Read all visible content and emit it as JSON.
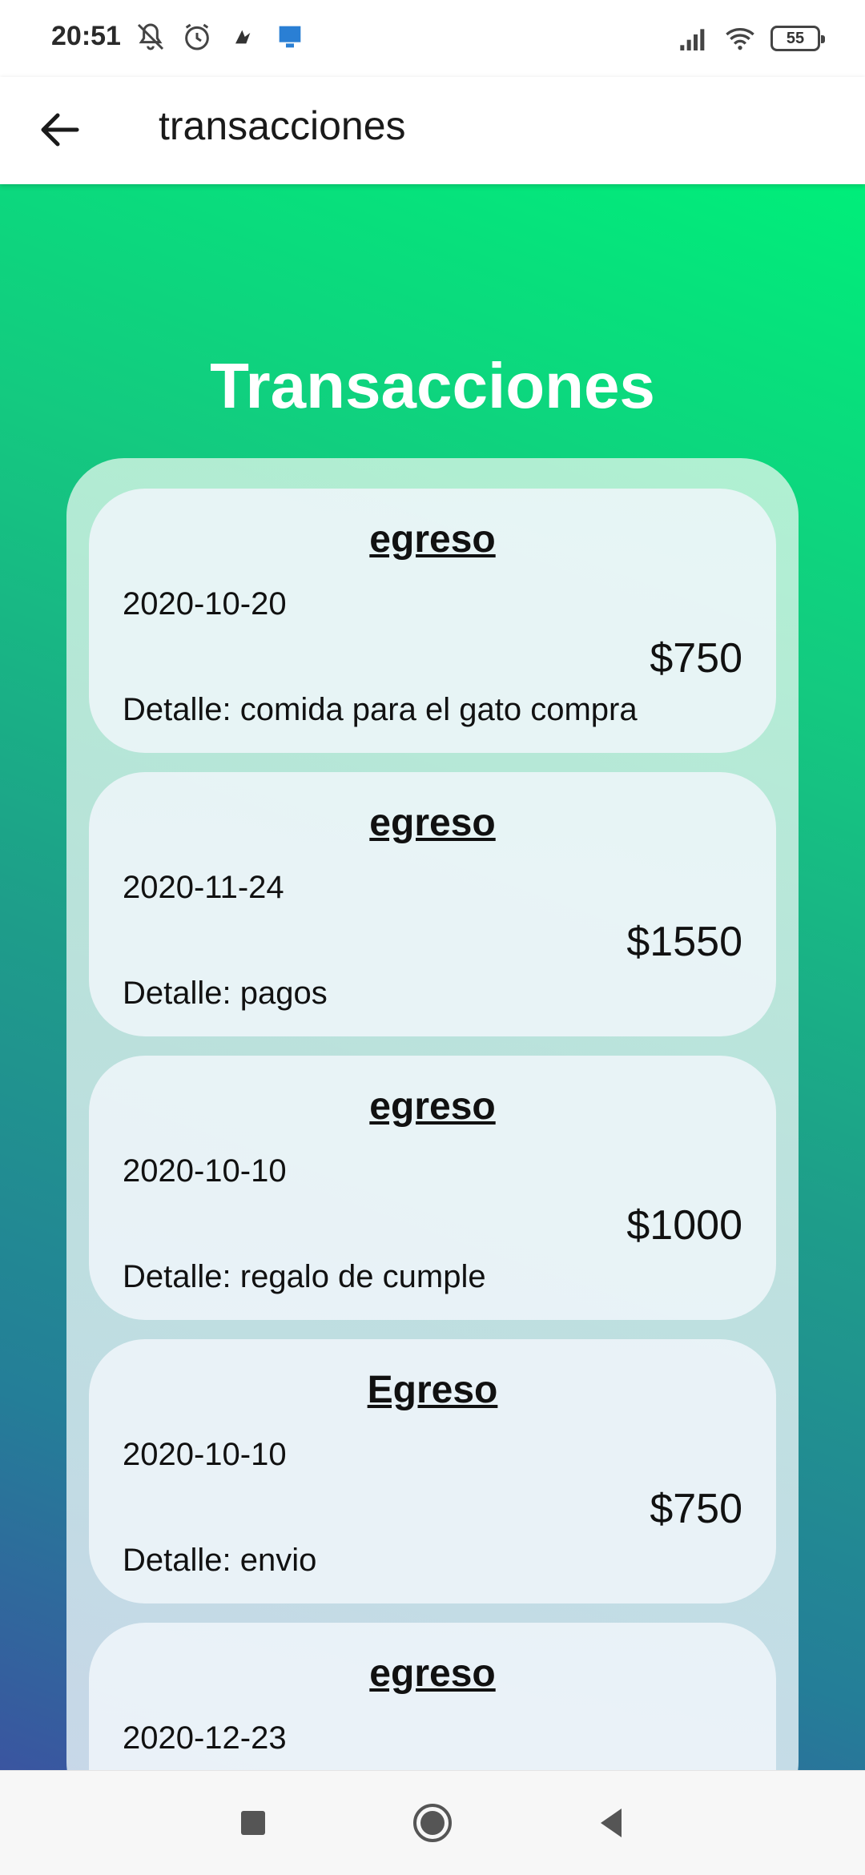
{
  "status_bar": {
    "time": "20:51",
    "battery": "55",
    "left_icons": [
      "bell-muted-icon",
      "alarm-icon",
      "app-notification-icon",
      "monitor-icon"
    ],
    "right_icons": [
      "signal-icon",
      "wifi-icon",
      "battery-icon"
    ]
  },
  "app_bar": {
    "title": "transacciones",
    "back_icon": "arrow-left-icon"
  },
  "page": {
    "heading": "Transacciones",
    "detail_prefix": "Detalle: "
  },
  "transactions": [
    {
      "type": "egreso",
      "date": "2020-10-20",
      "amount": "$750",
      "detail": "comida para el gato compra"
    },
    {
      "type": "egreso",
      "date": "2020-11-24",
      "amount": "$1550",
      "detail": "pagos"
    },
    {
      "type": "egreso",
      "date": "2020-10-10",
      "amount": "$1000",
      "detail": "regalo de cumple"
    },
    {
      "type": "Egreso",
      "date": "2020-10-10",
      "amount": "$750",
      "detail": "envio"
    },
    {
      "type": "egreso",
      "date": "2020-12-23",
      "amount": "",
      "detail": ""
    }
  ],
  "nav_bar": {
    "icons": [
      "recents-square-icon",
      "home-circle-icon",
      "back-triangle-icon"
    ]
  },
  "colors": {
    "gradient_top": "#00ee7a",
    "gradient_bottom": "#3a55a0",
    "heading_text": "#ffffff"
  }
}
